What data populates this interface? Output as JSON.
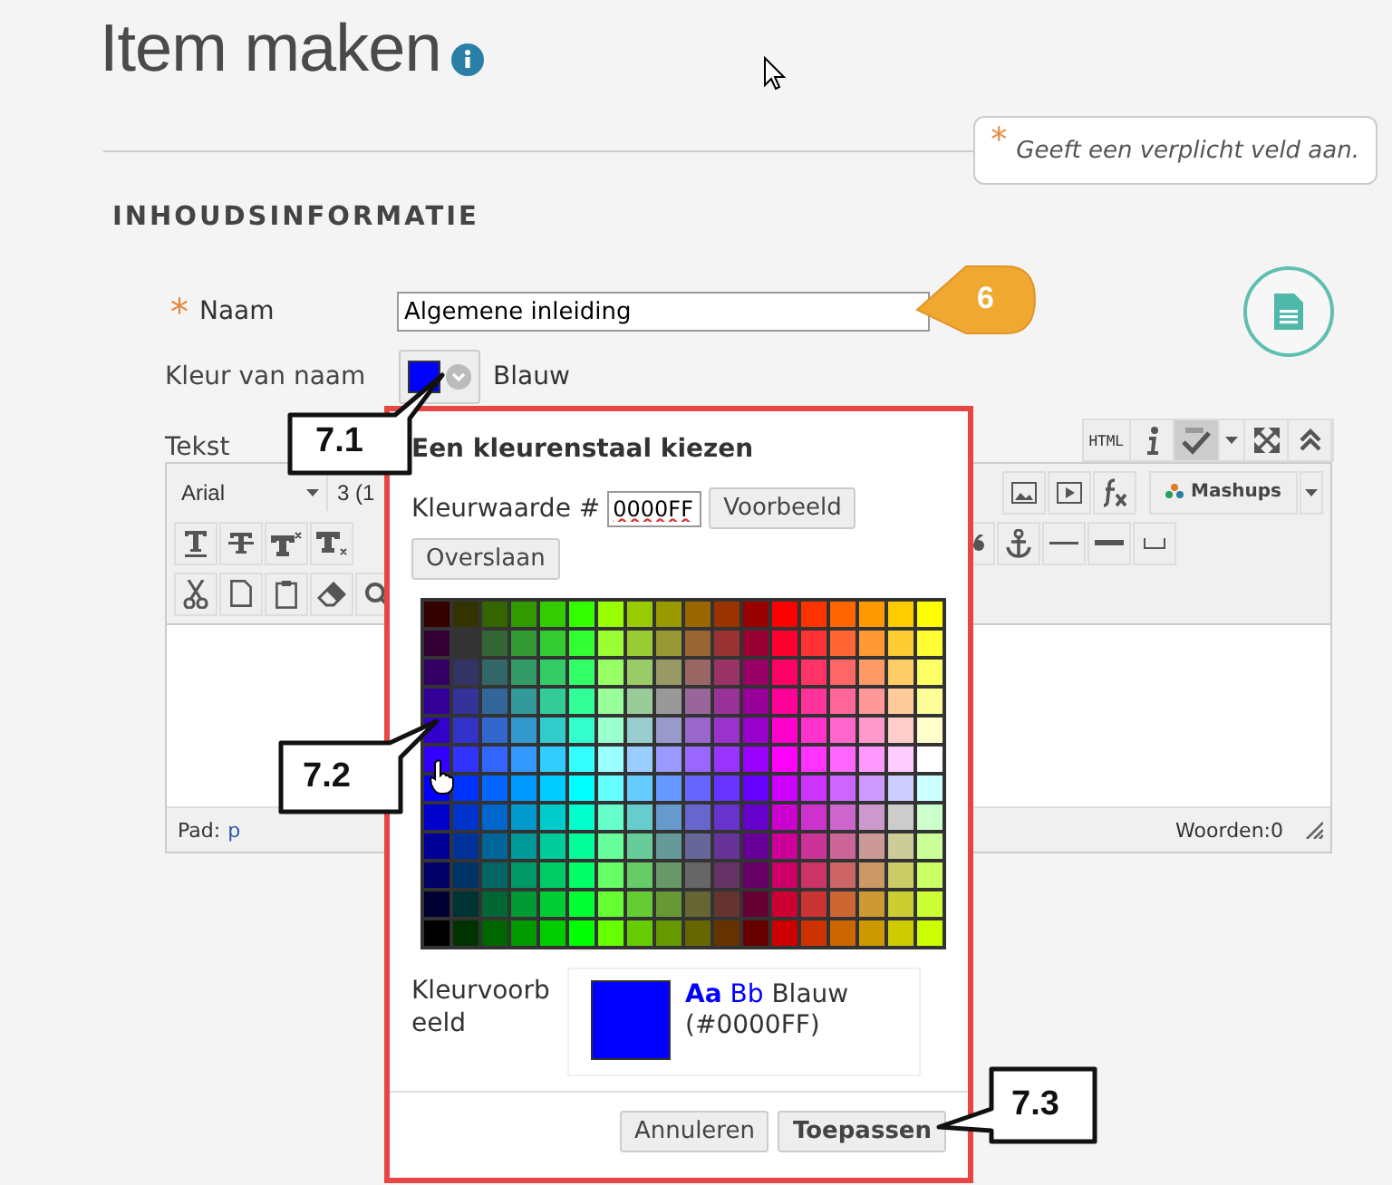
{
  "page": {
    "title": "Item maken",
    "required_mark": "*",
    "required_note": "Geeft een verplicht veld aan."
  },
  "section": {
    "heading": "INHOUDSINFORMATIE"
  },
  "name_field": {
    "required_mark": "*",
    "label": "Naam",
    "value": "Algemene inleiding"
  },
  "color_field": {
    "label": "Kleur van naam",
    "color": "#0000ff",
    "value": "Blauw"
  },
  "editor": {
    "label": "Tekst",
    "top_buttons": {
      "html": "HTML",
      "spellcheck_on": true
    },
    "font": "Arial",
    "size": "3 (1",
    "mashups": "Mashups",
    "path_label": "Pad:",
    "path_value": "p",
    "word_count": "Woorden:0"
  },
  "popup": {
    "title": "Een kleurenstaal kiezen",
    "value_label": "Kleurwaarde #",
    "value": "0000FF",
    "preview_button": "Voorbeeld",
    "skip_button": "Overslaan",
    "preview_label": "Kleurvoorbeeld",
    "sample_a": "Aa",
    "sample_b": "Bb",
    "color_name": "Blauw",
    "color_code": "(#0000FF)",
    "cancel_button": "Annuleren",
    "apply_button": "Toepassen"
  },
  "callouts": [
    {
      "kind": "badge",
      "label": "6"
    },
    {
      "kind": "box",
      "label": "7.1"
    },
    {
      "kind": "box",
      "label": "7.2"
    },
    {
      "kind": "box",
      "label": "7.3"
    }
  ]
}
